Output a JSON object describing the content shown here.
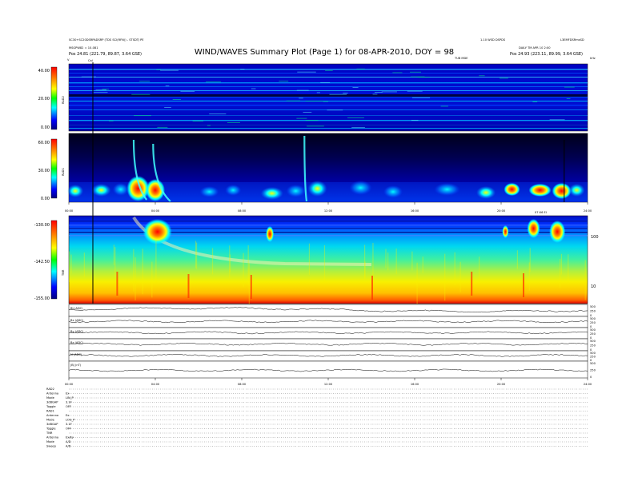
{
  "header": {
    "title": "WIND/WAVES Summary Plot (Page 1) for 08-APR-2010, DOY = 98",
    "left_line1": "SC30+SC20DSRPADSRP (TDS SCI(RFN)) - STSDTJ PE",
    "left_line2": "MSGPW82 = 10-081",
    "left_pos": "Pos   24.81 (221.79, 89.87, 3.64 GSE)",
    "right_line1": "1.10 WSD DSPDS",
    "right_line2": "DAILY TM APR 10 2:00",
    "right_pos": "Pos   24.93 (223.11, 89.99, 3.64 GSE)",
    "far_right": "L3EMFDSRmsSD",
    "units": "kHz"
  },
  "top_markers": {
    "left_glyph": "V",
    "cal": "Cal",
    "rt": "TUB MDE",
    "right_glyph": "kHz"
  },
  "chart_data": [
    {
      "type": "heatmap",
      "name": "RAD2",
      "ylabel": "RAD2",
      "colorbar_ticks": [
        "40.00",
        "20.00",
        "0.00"
      ],
      "colorbar_range": [
        0,
        40
      ]
    },
    {
      "type": "heatmap",
      "name": "RAD1",
      "ylabel": "RAD1",
      "colorbar_ticks": [
        "60.00",
        "30.00",
        "0.00"
      ],
      "colorbar_range": [
        0,
        60
      ],
      "x_ticks": [
        "00:00",
        "04:00",
        "08:00",
        "12:00",
        "16:00",
        "20:00",
        "24:00"
      ],
      "x_note": "07:06 EI"
    },
    {
      "type": "heatmap",
      "name": "TNR",
      "ylabel": "TNR",
      "colorbar_ticks": [
        "-130.00",
        "-142.50",
        "-155.00"
      ],
      "colorbar_range": [
        -155,
        -130
      ],
      "right_ticks": [
        "100",
        "10"
      ]
    },
    {
      "type": "line",
      "name": "B-field components",
      "series_labels": [
        "Bt (ADC)",
        "Bx (ADC)",
        "By (ADC)",
        "Bz (ADC)",
        "N (ADC)",
        "|B| (nT)"
      ],
      "right_ticks_primary": [
        "500",
        "250",
        "0"
      ],
      "x_ticks": [
        "00:00",
        "04:00",
        "08:00",
        "12:00",
        "16:00",
        "20:00",
        "24:00"
      ],
      "x_range": [
        0,
        24
      ]
    }
  ],
  "footer": {
    "rows": [
      {
        "label": "RAD2",
        "value": ""
      },
      {
        "label": "Antenna",
        "value": "Ex"
      },
      {
        "label": "Mode",
        "value": "LIN_P"
      },
      {
        "label": "3dBGAP",
        "value": "3.1F"
      },
      {
        "label": "Toggle",
        "value": "OFF"
      },
      {
        "label": "RAD1",
        "value": ""
      },
      {
        "label": "Antenna",
        "value": "Ex"
      },
      {
        "label": "Mode",
        "value": "LOG_P"
      },
      {
        "label": "3dBGAP",
        "value": "3.1F"
      },
      {
        "label": "Toggle",
        "value": "OFF"
      },
      {
        "label": "TNR",
        "value": ""
      },
      {
        "label": "Antenna",
        "value": "Ex/Ey"
      },
      {
        "label": "Mode",
        "value": "A/D"
      },
      {
        "label": "Sweep",
        "value": "A/D"
      }
    ]
  },
  "colors": {
    "dark": "#000080",
    "blue": "#0000ff",
    "cyan": "#00ffff",
    "green": "#00ff00",
    "yellow": "#ffff00",
    "orange": "#ff8000",
    "red": "#ff0000"
  }
}
